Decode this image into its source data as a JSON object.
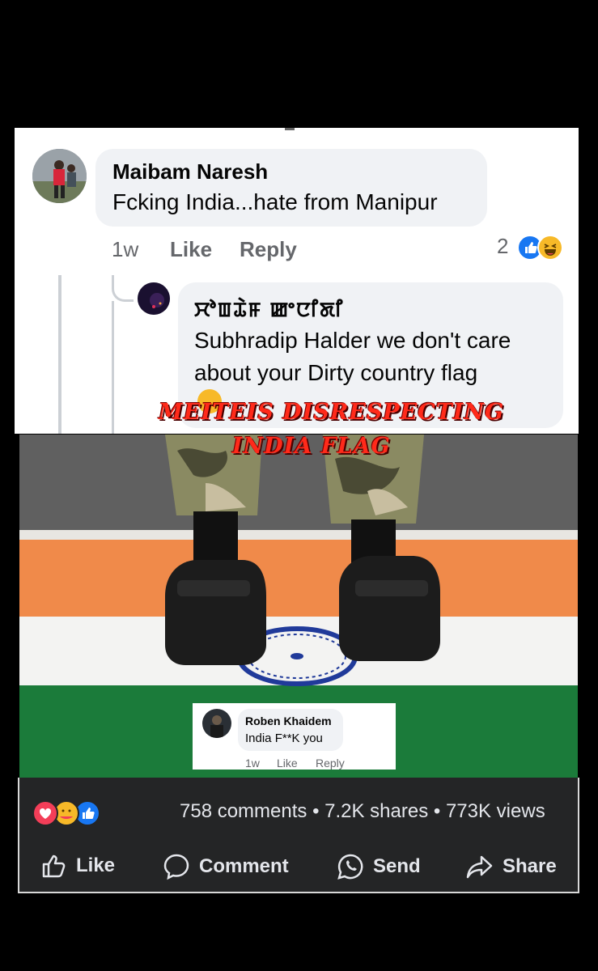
{
  "comment1": {
    "author": "Maibam Naresh",
    "text": "Fcking India...hate from Manipur",
    "time": "1w",
    "like_label": "Like",
    "reply_label": "Reply",
    "reaction_count": "2"
  },
  "reply1": {
    "author": "ꯆꯣꯡꯊꯥꯝ ꯀꯦꯅꯤꯗꯤ",
    "text_line1": "Subhradip Halder we don't care",
    "text_line2": "about your Dirty country flag"
  },
  "overlay": {
    "line1": "MEITEIS DISRESPECTING",
    "line2": "INDIA FLAG"
  },
  "embedded_comment": {
    "author": "Roben Khaidem",
    "text": "India F**K you",
    "time": "1w",
    "like_label": "Like",
    "reply_label": "Reply"
  },
  "post_stats": {
    "summary": "758 comments • 7.2K shares • 773K views"
  },
  "actions": {
    "like": "Like",
    "comment": "Comment",
    "send": "Send",
    "share": "Share"
  },
  "colors": {
    "like_blue": "#1877f2",
    "haha_yellow": "#f7b928",
    "love_red": "#f33e58",
    "overlay_red": "#ff2a1a"
  }
}
